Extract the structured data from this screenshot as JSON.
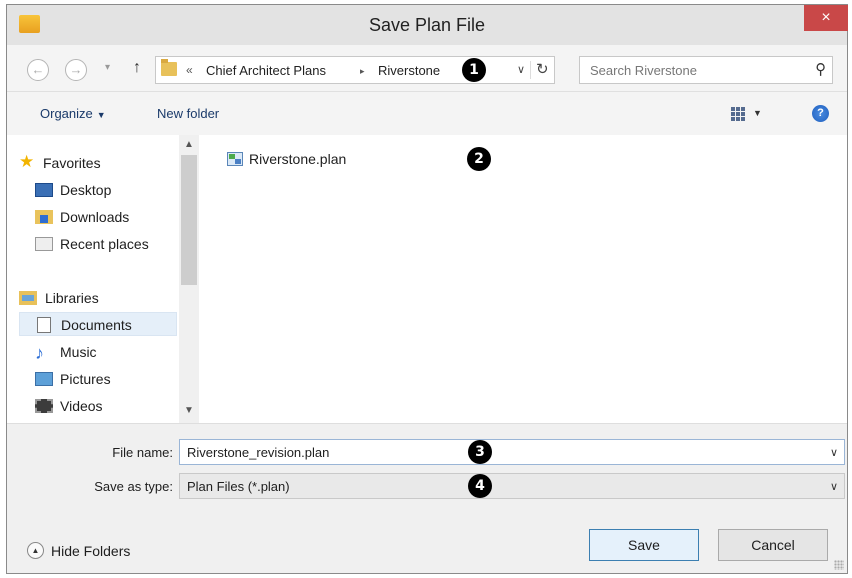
{
  "window": {
    "title": "Save Plan File",
    "close_label": "×"
  },
  "navbar": {
    "back_glyph": "←",
    "forward_glyph": "→",
    "recent_glyph": "▾",
    "up_glyph": "↑",
    "breadcrumb_prefix": "«",
    "breadcrumbs": [
      "Chief Architect Plans",
      "Riverstone"
    ],
    "crumb_separator": "▸",
    "dropdown_glyph": "∨",
    "refresh_glyph": "↻",
    "search_placeholder": "Search Riverstone",
    "search_glyph": "⚲"
  },
  "toolbar": {
    "organize_label": "Organize",
    "organize_caret": "▼",
    "new_folder_label": "New folder",
    "views_caret": "▼",
    "help_label": "?"
  },
  "sidebar": {
    "scroll_up": "▲",
    "scroll_down": "▼",
    "items": [
      {
        "label": "Favorites",
        "icon": "star-icon",
        "glyph": "★"
      },
      {
        "label": "Desktop",
        "icon": "desktop-icon"
      },
      {
        "label": "Downloads",
        "icon": "downloads-icon"
      },
      {
        "label": "Recent places",
        "icon": "recent-places-icon"
      },
      {
        "label": "Libraries",
        "icon": "libraries-icon"
      },
      {
        "label": "Documents",
        "icon": "documents-icon",
        "selected": true
      },
      {
        "label": "Music",
        "icon": "music-icon",
        "glyph": "♪"
      },
      {
        "label": "Pictures",
        "icon": "pictures-icon"
      },
      {
        "label": "Videos",
        "icon": "videos-icon"
      }
    ]
  },
  "files": [
    {
      "name": "Riverstone.plan",
      "icon": "plan-file-icon"
    }
  ],
  "form": {
    "file_name_label": "File name:",
    "file_name_value": "Riverstone_revision.plan",
    "save_type_label": "Save as type:",
    "save_type_value": "Plan Files (*.plan)",
    "chevron_glyph": "∨"
  },
  "footer": {
    "hide_folders_label": "Hide Folders",
    "hide_folders_glyph": "▲",
    "save_label": "Save",
    "cancel_label": "Cancel"
  },
  "callouts": [
    "1",
    "2",
    "3",
    "4"
  ]
}
